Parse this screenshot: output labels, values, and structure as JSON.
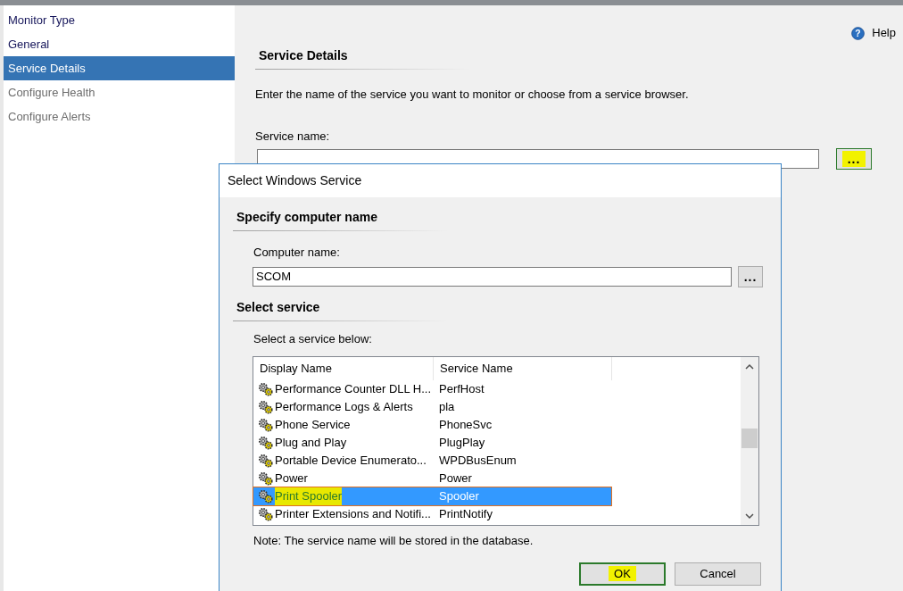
{
  "sidebar": {
    "items": [
      {
        "label": "Monitor Type",
        "selected": false,
        "disabled": false
      },
      {
        "label": "General",
        "selected": false,
        "disabled": false
      },
      {
        "label": "Service Details",
        "selected": true,
        "disabled": false
      },
      {
        "label": "Configure Health",
        "selected": false,
        "disabled": true
      },
      {
        "label": "Configure Alerts",
        "selected": false,
        "disabled": true
      }
    ]
  },
  "help": {
    "icon": "?",
    "label": "Help"
  },
  "page": {
    "heading": "Service Details",
    "description": "Enter the name of the service you want to monitor or choose from a service browser.",
    "service_name_label": "Service name:",
    "browse_button": {
      "label": "...",
      "highlighted": true
    }
  },
  "dialog": {
    "title": "Select Windows Service",
    "computer_section": {
      "heading": "Specify computer name",
      "label": "Computer name:",
      "value": "SCOM",
      "browse_button": {
        "label": "...",
        "highlighted": false
      }
    },
    "service_section": {
      "heading": "Select service",
      "label": "Select a service below:",
      "columns": [
        "Display Name",
        "Service Name"
      ],
      "rows": [
        {
          "display_name": "Performance Counter DLL H...",
          "service_name": "PerfHost",
          "selected": false,
          "highlighted": false
        },
        {
          "display_name": "Performance Logs & Alerts",
          "service_name": "pla",
          "selected": false,
          "highlighted": false
        },
        {
          "display_name": "Phone Service",
          "service_name": "PhoneSvc",
          "selected": false,
          "highlighted": false
        },
        {
          "display_name": "Plug and Play",
          "service_name": "PlugPlay",
          "selected": false,
          "highlighted": false
        },
        {
          "display_name": "Portable Device Enumerato...",
          "service_name": "WPDBusEnum",
          "selected": false,
          "highlighted": false
        },
        {
          "display_name": "Power",
          "service_name": "Power",
          "selected": false,
          "highlighted": false
        },
        {
          "display_name": "Print Spooler",
          "service_name": "Spooler",
          "selected": true,
          "highlighted": true
        },
        {
          "display_name": "Printer Extensions and Notifi...",
          "service_name": "PrintNotify",
          "selected": false,
          "highlighted": false
        }
      ],
      "note": "Note: The service name will be stored in the database."
    },
    "buttons": [
      {
        "label": "OK",
        "default": true,
        "highlighted": true
      },
      {
        "label": "Cancel",
        "default": false,
        "highlighted": false
      }
    ]
  }
}
